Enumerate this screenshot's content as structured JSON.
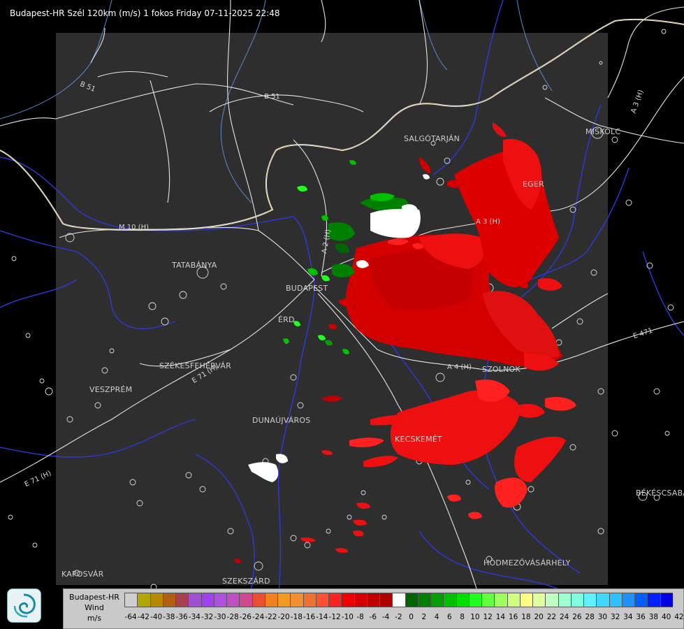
{
  "title": "Budapest-HR Szél 120km (m/s) 1 fokos Friday 07-11-2025 22:48",
  "cities": [
    {
      "name": "SALGÓTARJÁN"
    },
    {
      "name": "MISKOLC"
    },
    {
      "name": "EGER"
    },
    {
      "name": "TATABÁNYA"
    },
    {
      "name": "BUDAPEST"
    },
    {
      "name": "ÉRD"
    },
    {
      "name": "SZÉKESFEHÉRVÁR"
    },
    {
      "name": "VESZPRÉM"
    },
    {
      "name": "DUNAÚJVÁROS"
    },
    {
      "name": "KECSKEMÉT"
    },
    {
      "name": "SZOLNOK"
    },
    {
      "name": "HÓDMEZŐVÁSÁRHELY"
    },
    {
      "name": "BÉKÉSCSABA"
    },
    {
      "name": "KAPOSVÁR"
    },
    {
      "name": "SZEKSZÁRD"
    }
  ],
  "roads": [
    "B 51",
    "B 51",
    "M 10 (H)",
    "A 3 (H)",
    "A 3 (H)",
    "A 2 (H)",
    "E 471",
    "A 4 (H)",
    "E 71 (H)",
    "E 71 (H)"
  ],
  "legend": {
    "title": [
      "Budapest-HR",
      "Wind",
      "m/s"
    ],
    "values": [
      "-64",
      "-42",
      "-40",
      "-38",
      "-36",
      "-34",
      "-32",
      "-30",
      "-28",
      "-26",
      "-24",
      "-22",
      "-20",
      "-18",
      "-16",
      "-14",
      "-12",
      "-10",
      "-8",
      "-6",
      "-4",
      "-2",
      "0",
      "2",
      "4",
      "6",
      "8",
      "10",
      "12",
      "14",
      "16",
      "18",
      "20",
      "22",
      "24",
      "26",
      "28",
      "30",
      "32",
      "34",
      "36",
      "38",
      "40",
      "42"
    ],
    "colors": [
      "#cfcfcf",
      "#b0a800",
      "#b88800",
      "#b06010",
      "#a84050",
      "#a050d0",
      "#a040f0",
      "#b050e0",
      "#c050c0",
      "#d04890",
      "#e85030",
      "#f08020",
      "#f09a20",
      "#f09030",
      "#f07030",
      "#ff5030",
      "#ff2020",
      "#ee0000",
      "#d40000",
      "#c00000",
      "#b00000",
      "#ffffff",
      "#006400",
      "#008000",
      "#00a000",
      "#00c000",
      "#00e000",
      "#20ff20",
      "#60ff40",
      "#a0ff60",
      "#d0ff80",
      "#ffff80",
      "#e0ffa0",
      "#c0ffc0",
      "#a0ffd0",
      "#80ffe0",
      "#60f0ff",
      "#40d8ff",
      "#30c0ff",
      "#2090ff",
      "#0060ff",
      "#0020ff",
      "#0000e0"
    ]
  }
}
